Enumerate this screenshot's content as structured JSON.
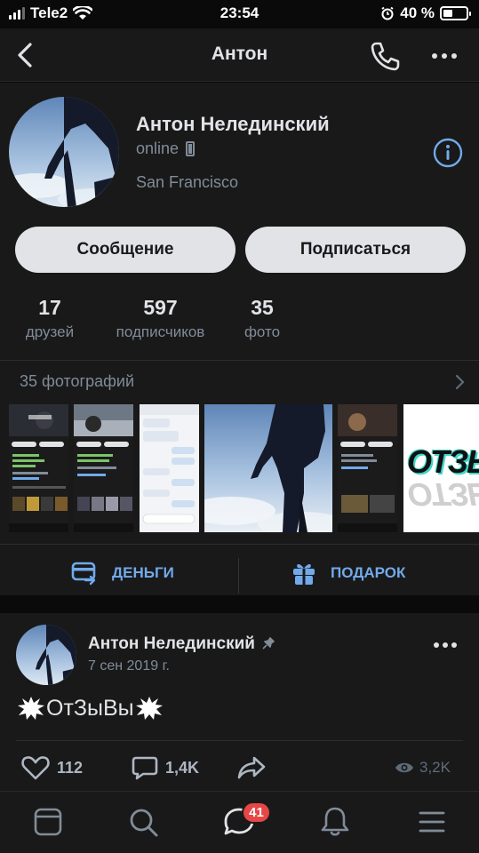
{
  "status_bar": {
    "carrier": "Tele2",
    "time": "23:54",
    "battery": "40 %",
    "battery_level": 0.4
  },
  "nav": {
    "title": "Антон",
    "icons": [
      "chevron-left-icon",
      "phone-icon",
      "more-horizontal-icon"
    ]
  },
  "profile": {
    "name": "Антон Нелединский",
    "status": "online",
    "city": "San Francisco",
    "message_button": "Сообщение",
    "subscribe_button": "Подписаться",
    "counters": [
      {
        "value": "17",
        "label": "друзей"
      },
      {
        "value": "597",
        "label": "подписчиков"
      },
      {
        "value": "35",
        "label": "фото"
      }
    ]
  },
  "photos": {
    "header": "35 фотографий",
    "embedded_texts": [
      "ОТЗЫВЫ"
    ]
  },
  "actions": {
    "money": "ДЕНЬГИ",
    "gift": "ПОДАРОК"
  },
  "post": {
    "author": "Антон Нелединский",
    "date": "7 сен 2019 г.",
    "text": "ОтЗыВы",
    "likes": "112",
    "comments": "1,4K",
    "views": "3,2K"
  },
  "tabbar": {
    "messages_badge": "41",
    "icons": [
      "news-icon",
      "search-icon",
      "messages-icon",
      "notifications-icon",
      "menu-icon"
    ]
  },
  "colors": {
    "background": "#0a0a0a",
    "card": "#191919",
    "accent": "#71aaeb",
    "badge": "#e64646",
    "secondary_text": "#818c99"
  }
}
